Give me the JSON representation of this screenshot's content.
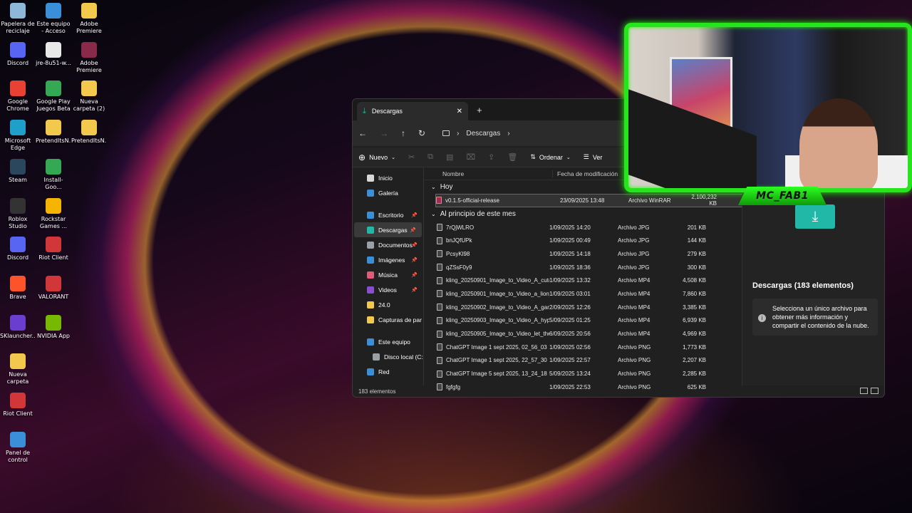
{
  "desktop": {
    "icons": [
      {
        "label": "Papelera de reciclaje",
        "icon": "recycle-bin-icon",
        "color": "#8fb8d8"
      },
      {
        "label": "Este equipo - Acceso dir...",
        "icon": "this-pc-icon",
        "color": "#3a8fd8"
      },
      {
        "label": "Adobe Premiere Pr...",
        "icon": "folder-icon",
        "color": "#f2c94c"
      },
      {
        "label": "Discord",
        "icon": "discord-icon",
        "color": "#5865f2"
      },
      {
        "label": "jre-8u51-w...",
        "icon": "java-installer-icon",
        "color": "#e8e8e8"
      },
      {
        "label": "Adobe Premiere Pr...",
        "icon": "winrar-icon",
        "color": "#8a2a4a"
      },
      {
        "label": "Google Chrome",
        "icon": "chrome-icon",
        "color": "#e94235"
      },
      {
        "label": "Google Play Juegos Beta",
        "icon": "google-play-games-icon",
        "color": "#34a853"
      },
      {
        "label": "Nueva carpeta (2)",
        "icon": "folder-icon",
        "color": "#f2c94c"
      },
      {
        "label": "Microsoft Edge",
        "icon": "edge-icon",
        "color": "#1fa0c8"
      },
      {
        "label": "PretendItsN...",
        "icon": "folder-icon",
        "color": "#f2c94c"
      },
      {
        "label": "PretendItsN...",
        "icon": "folder-icon",
        "color": "#f2c94c"
      },
      {
        "label": "Steam",
        "icon": "steam-icon",
        "color": "#2a475e"
      },
      {
        "label": "Install-Goo...",
        "icon": "google-play-installer-icon",
        "color": "#34a853"
      },
      {
        "label": "Roblox Studio",
        "icon": "roblox-studio-icon",
        "color": "#333333"
      },
      {
        "label": "Rockstar Games ...",
        "icon": "rockstar-icon",
        "color": "#f4b400"
      },
      {
        "label": "Discord",
        "icon": "discord-icon",
        "color": "#5865f2"
      },
      {
        "label": "Riot Client",
        "icon": "riot-client-icon",
        "color": "#d13639"
      },
      {
        "label": "Brave",
        "icon": "brave-icon",
        "color": "#fb542b"
      },
      {
        "label": "VALORANT",
        "icon": "valorant-icon",
        "color": "#d13639"
      },
      {
        "label": "SKlauncher...",
        "icon": "sklauncher-icon",
        "color": "#6a3fd0"
      },
      {
        "label": "NVIDIA App",
        "icon": "nvidia-icon",
        "color": "#76b900"
      },
      {
        "label": "Nueva carpeta",
        "icon": "folder-icon",
        "color": "#f2c94c"
      },
      {
        "label": "Riot Client",
        "icon": "riot-client-icon",
        "color": "#d13639"
      },
      {
        "label": "Panel de control",
        "icon": "control-panel-icon",
        "color": "#3a8fd8"
      }
    ]
  },
  "explorer": {
    "tab_title": "Descargas",
    "address": [
      "Descargas"
    ],
    "toolbar": {
      "new_label": "Nuevo",
      "sort_label": "Ordenar",
      "view_label": "Ver"
    },
    "sidebar": [
      {
        "label": "Inicio",
        "icon": "home-icon",
        "color": "#d8d8d8"
      },
      {
        "label": "Galería",
        "icon": "gallery-icon",
        "color": "#3a8fd8"
      },
      {
        "label": "Escritorio",
        "icon": "desktop-folder-icon",
        "color": "#3a8fd8",
        "pinned": true
      },
      {
        "label": "Descargas",
        "icon": "downloads-icon",
        "color": "#21b8a8",
        "pinned": true,
        "active": true
      },
      {
        "label": "Documentos",
        "icon": "documents-icon",
        "color": "#9aa0a6",
        "pinned": true
      },
      {
        "label": "Imágenes",
        "icon": "pictures-icon",
        "color": "#3a8fd8",
        "pinned": true
      },
      {
        "label": "Música",
        "icon": "music-icon",
        "color": "#e05a7a",
        "pinned": true
      },
      {
        "label": "Videos",
        "icon": "videos-icon",
        "color": "#8a4fd0",
        "pinned": true
      },
      {
        "label": "24.0",
        "icon": "folder-icon",
        "color": "#f2c94c"
      },
      {
        "label": "Capturas de par",
        "icon": "folder-icon",
        "color": "#f2c94c"
      },
      {
        "label": "Este equipo",
        "icon": "this-pc-icon",
        "color": "#3a8fd8"
      },
      {
        "label": "Disco local (C:",
        "icon": "drive-icon",
        "color": "#9aa0a6"
      },
      {
        "label": "Red",
        "icon": "network-icon",
        "color": "#3a8fd8"
      }
    ],
    "columns": {
      "name": "Nombre",
      "date": "Fecha de modificación"
    },
    "groups": {
      "today": "Hoy",
      "month": "Al principio de este mes"
    },
    "today_files": [
      {
        "name": "v0.1.5-official-release",
        "date": "23/09/2025 13:48",
        "type": "Archivo WinRAR",
        "size": "2,100,232 KB"
      }
    ],
    "month_files": [
      {
        "name": "7rQjWLRO",
        "date": "1/09/2025 14:20",
        "type": "Archivo JPG",
        "size": "201 KB"
      },
      {
        "name": "bnJQfUPk",
        "date": "1/09/2025 00:49",
        "type": "Archivo JPG",
        "size": "144 KB"
      },
      {
        "name": "PcsyKl98",
        "date": "1/09/2025 14:18",
        "type": "Archivo JPG",
        "size": "279 KB"
      },
      {
        "name": "qZSsF0y9",
        "date": "1/09/2025 18:36",
        "type": "Archivo JPG",
        "size": "300 KB"
      },
      {
        "name": "kling_20250901_Image_to_Video_A_cute_d...",
        "date": "1/09/2025 13:32",
        "type": "Archivo MP4",
        "size": "4,508 KB"
      },
      {
        "name": "kling_20250901_Image_to_Video_a_lion_d...",
        "date": "1/09/2025 03:01",
        "type": "Archivo MP4",
        "size": "7,860 KB"
      },
      {
        "name": "kling_20250902_Image_to_Video_A_game...",
        "date": "2/09/2025 12:26",
        "type": "Archivo MP4",
        "size": "3,385 KB"
      },
      {
        "name": "kling_20250903_Image_to_Video_A_hyper...",
        "date": "5/09/2025 01:25",
        "type": "Archivo MP4",
        "size": "6,939 KB"
      },
      {
        "name": "kling_20250905_Image_to_Video_let_the_...",
        "date": "6/09/2025 20:56",
        "type": "Archivo MP4",
        "size": "4,969 KB"
      },
      {
        "name": "ChatGPT Image 1 sept 2025, 02_56_03",
        "date": "1/09/2025 02:56",
        "type": "Archivo PNG",
        "size": "1,773 KB"
      },
      {
        "name": "ChatGPT Image 1 sept 2025, 22_57_30",
        "date": "1/09/2025 22:57",
        "type": "Archivo PNG",
        "size": "2,207 KB"
      },
      {
        "name": "ChatGPT Image 5 sept 2025, 13_24_18",
        "date": "5/09/2025 13:24",
        "type": "Archivo PNG",
        "size": "2,285 KB"
      },
      {
        "name": "fgfgfg",
        "date": "1/09/2025 22:53",
        "type": "Archivo PNG",
        "size": "625 KB"
      }
    ],
    "details": {
      "title": "Descargas (183 elementos)",
      "info": "Selecciona un único archivo para obtener más información y compartir el contenido de la nube."
    },
    "status": "183 elementos"
  },
  "stream": {
    "name": "MC_FAB1",
    "frame_color": "#27e51c"
  }
}
